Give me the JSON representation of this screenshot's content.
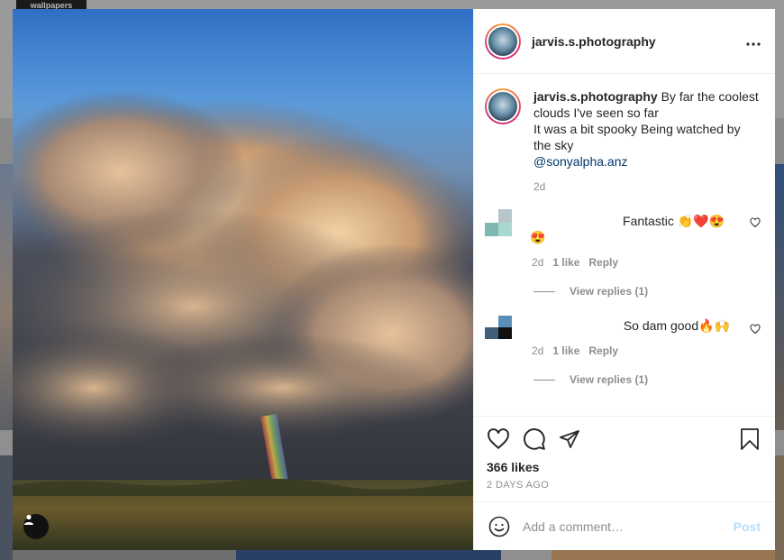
{
  "background": {
    "logo_text": "wallpapers"
  },
  "post": {
    "username": "jarvis.s.photography",
    "more_label": "•••",
    "caption": {
      "username": "jarvis.s.photography",
      "line1": "By far the coolest clouds I've seen so far",
      "line2": "It was a bit spooky Being watched by the sky",
      "mention": "@sonyalpha.anz",
      "time": "2d"
    },
    "comments": [
      {
        "text": "Fantastic 👏❤️😍",
        "text2": "😍",
        "time": "2d",
        "likes": "1 like",
        "reply": "Reply",
        "view_replies": "View replies (1)"
      },
      {
        "text": "So dam good🔥🙌",
        "time": "2d",
        "likes": "1 like",
        "reply": "Reply",
        "view_replies": "View replies (1)"
      }
    ],
    "likes": "366 likes",
    "posted": "2 DAYS AGO",
    "add_comment_placeholder": "Add a comment…",
    "post_button": "Post"
  },
  "icons": [
    "heart-icon",
    "comment-icon",
    "share-icon",
    "bookmark-icon",
    "emoji-icon",
    "user-tag-icon",
    "more-icon"
  ],
  "colors": {
    "accent": "#0095f6",
    "post_disabled": "#b2dffc",
    "mention": "#00376b"
  }
}
